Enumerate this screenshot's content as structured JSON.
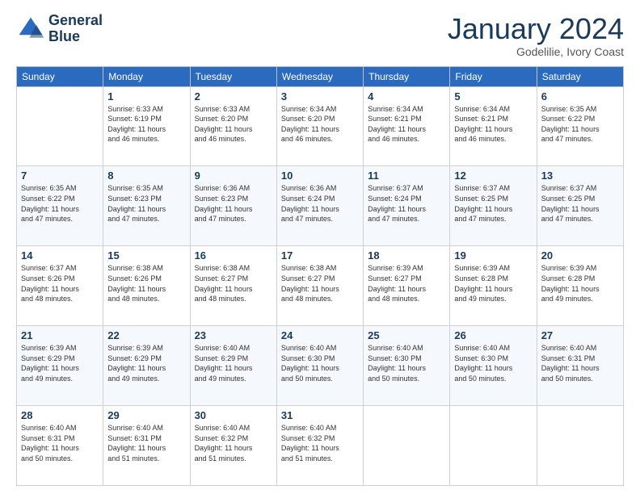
{
  "logo": {
    "line1": "General",
    "line2": "Blue"
  },
  "title": "January 2024",
  "subtitle": "Godelilie, Ivory Coast",
  "header_row": [
    "Sunday",
    "Monday",
    "Tuesday",
    "Wednesday",
    "Thursday",
    "Friday",
    "Saturday"
  ],
  "weeks": [
    [
      {
        "day": "",
        "info": ""
      },
      {
        "day": "1",
        "info": "Sunrise: 6:33 AM\nSunset: 6:19 PM\nDaylight: 11 hours\nand 46 minutes."
      },
      {
        "day": "2",
        "info": "Sunrise: 6:33 AM\nSunset: 6:20 PM\nDaylight: 11 hours\nand 46 minutes."
      },
      {
        "day": "3",
        "info": "Sunrise: 6:34 AM\nSunset: 6:20 PM\nDaylight: 11 hours\nand 46 minutes."
      },
      {
        "day": "4",
        "info": "Sunrise: 6:34 AM\nSunset: 6:21 PM\nDaylight: 11 hours\nand 46 minutes."
      },
      {
        "day": "5",
        "info": "Sunrise: 6:34 AM\nSunset: 6:21 PM\nDaylight: 11 hours\nand 46 minutes."
      },
      {
        "day": "6",
        "info": "Sunrise: 6:35 AM\nSunset: 6:22 PM\nDaylight: 11 hours\nand 47 minutes."
      }
    ],
    [
      {
        "day": "7",
        "info": "Sunrise: 6:35 AM\nSunset: 6:22 PM\nDaylight: 11 hours\nand 47 minutes."
      },
      {
        "day": "8",
        "info": "Sunrise: 6:35 AM\nSunset: 6:23 PM\nDaylight: 11 hours\nand 47 minutes."
      },
      {
        "day": "9",
        "info": "Sunrise: 6:36 AM\nSunset: 6:23 PM\nDaylight: 11 hours\nand 47 minutes."
      },
      {
        "day": "10",
        "info": "Sunrise: 6:36 AM\nSunset: 6:24 PM\nDaylight: 11 hours\nand 47 minutes."
      },
      {
        "day": "11",
        "info": "Sunrise: 6:37 AM\nSunset: 6:24 PM\nDaylight: 11 hours\nand 47 minutes."
      },
      {
        "day": "12",
        "info": "Sunrise: 6:37 AM\nSunset: 6:25 PM\nDaylight: 11 hours\nand 47 minutes."
      },
      {
        "day": "13",
        "info": "Sunrise: 6:37 AM\nSunset: 6:25 PM\nDaylight: 11 hours\nand 47 minutes."
      }
    ],
    [
      {
        "day": "14",
        "info": "Sunrise: 6:37 AM\nSunset: 6:26 PM\nDaylight: 11 hours\nand 48 minutes."
      },
      {
        "day": "15",
        "info": "Sunrise: 6:38 AM\nSunset: 6:26 PM\nDaylight: 11 hours\nand 48 minutes."
      },
      {
        "day": "16",
        "info": "Sunrise: 6:38 AM\nSunset: 6:27 PM\nDaylight: 11 hours\nand 48 minutes."
      },
      {
        "day": "17",
        "info": "Sunrise: 6:38 AM\nSunset: 6:27 PM\nDaylight: 11 hours\nand 48 minutes."
      },
      {
        "day": "18",
        "info": "Sunrise: 6:39 AM\nSunset: 6:27 PM\nDaylight: 11 hours\nand 48 minutes."
      },
      {
        "day": "19",
        "info": "Sunrise: 6:39 AM\nSunset: 6:28 PM\nDaylight: 11 hours\nand 49 minutes."
      },
      {
        "day": "20",
        "info": "Sunrise: 6:39 AM\nSunset: 6:28 PM\nDaylight: 11 hours\nand 49 minutes."
      }
    ],
    [
      {
        "day": "21",
        "info": "Sunrise: 6:39 AM\nSunset: 6:29 PM\nDaylight: 11 hours\nand 49 minutes."
      },
      {
        "day": "22",
        "info": "Sunrise: 6:39 AM\nSunset: 6:29 PM\nDaylight: 11 hours\nand 49 minutes."
      },
      {
        "day": "23",
        "info": "Sunrise: 6:40 AM\nSunset: 6:29 PM\nDaylight: 11 hours\nand 49 minutes."
      },
      {
        "day": "24",
        "info": "Sunrise: 6:40 AM\nSunset: 6:30 PM\nDaylight: 11 hours\nand 50 minutes."
      },
      {
        "day": "25",
        "info": "Sunrise: 6:40 AM\nSunset: 6:30 PM\nDaylight: 11 hours\nand 50 minutes."
      },
      {
        "day": "26",
        "info": "Sunrise: 6:40 AM\nSunset: 6:30 PM\nDaylight: 11 hours\nand 50 minutes."
      },
      {
        "day": "27",
        "info": "Sunrise: 6:40 AM\nSunset: 6:31 PM\nDaylight: 11 hours\nand 50 minutes."
      }
    ],
    [
      {
        "day": "28",
        "info": "Sunrise: 6:40 AM\nSunset: 6:31 PM\nDaylight: 11 hours\nand 50 minutes."
      },
      {
        "day": "29",
        "info": "Sunrise: 6:40 AM\nSunset: 6:31 PM\nDaylight: 11 hours\nand 51 minutes."
      },
      {
        "day": "30",
        "info": "Sunrise: 6:40 AM\nSunset: 6:32 PM\nDaylight: 11 hours\nand 51 minutes."
      },
      {
        "day": "31",
        "info": "Sunrise: 6:40 AM\nSunset: 6:32 PM\nDaylight: 11 hours\nand 51 minutes."
      },
      {
        "day": "",
        "info": ""
      },
      {
        "day": "",
        "info": ""
      },
      {
        "day": "",
        "info": ""
      }
    ]
  ]
}
